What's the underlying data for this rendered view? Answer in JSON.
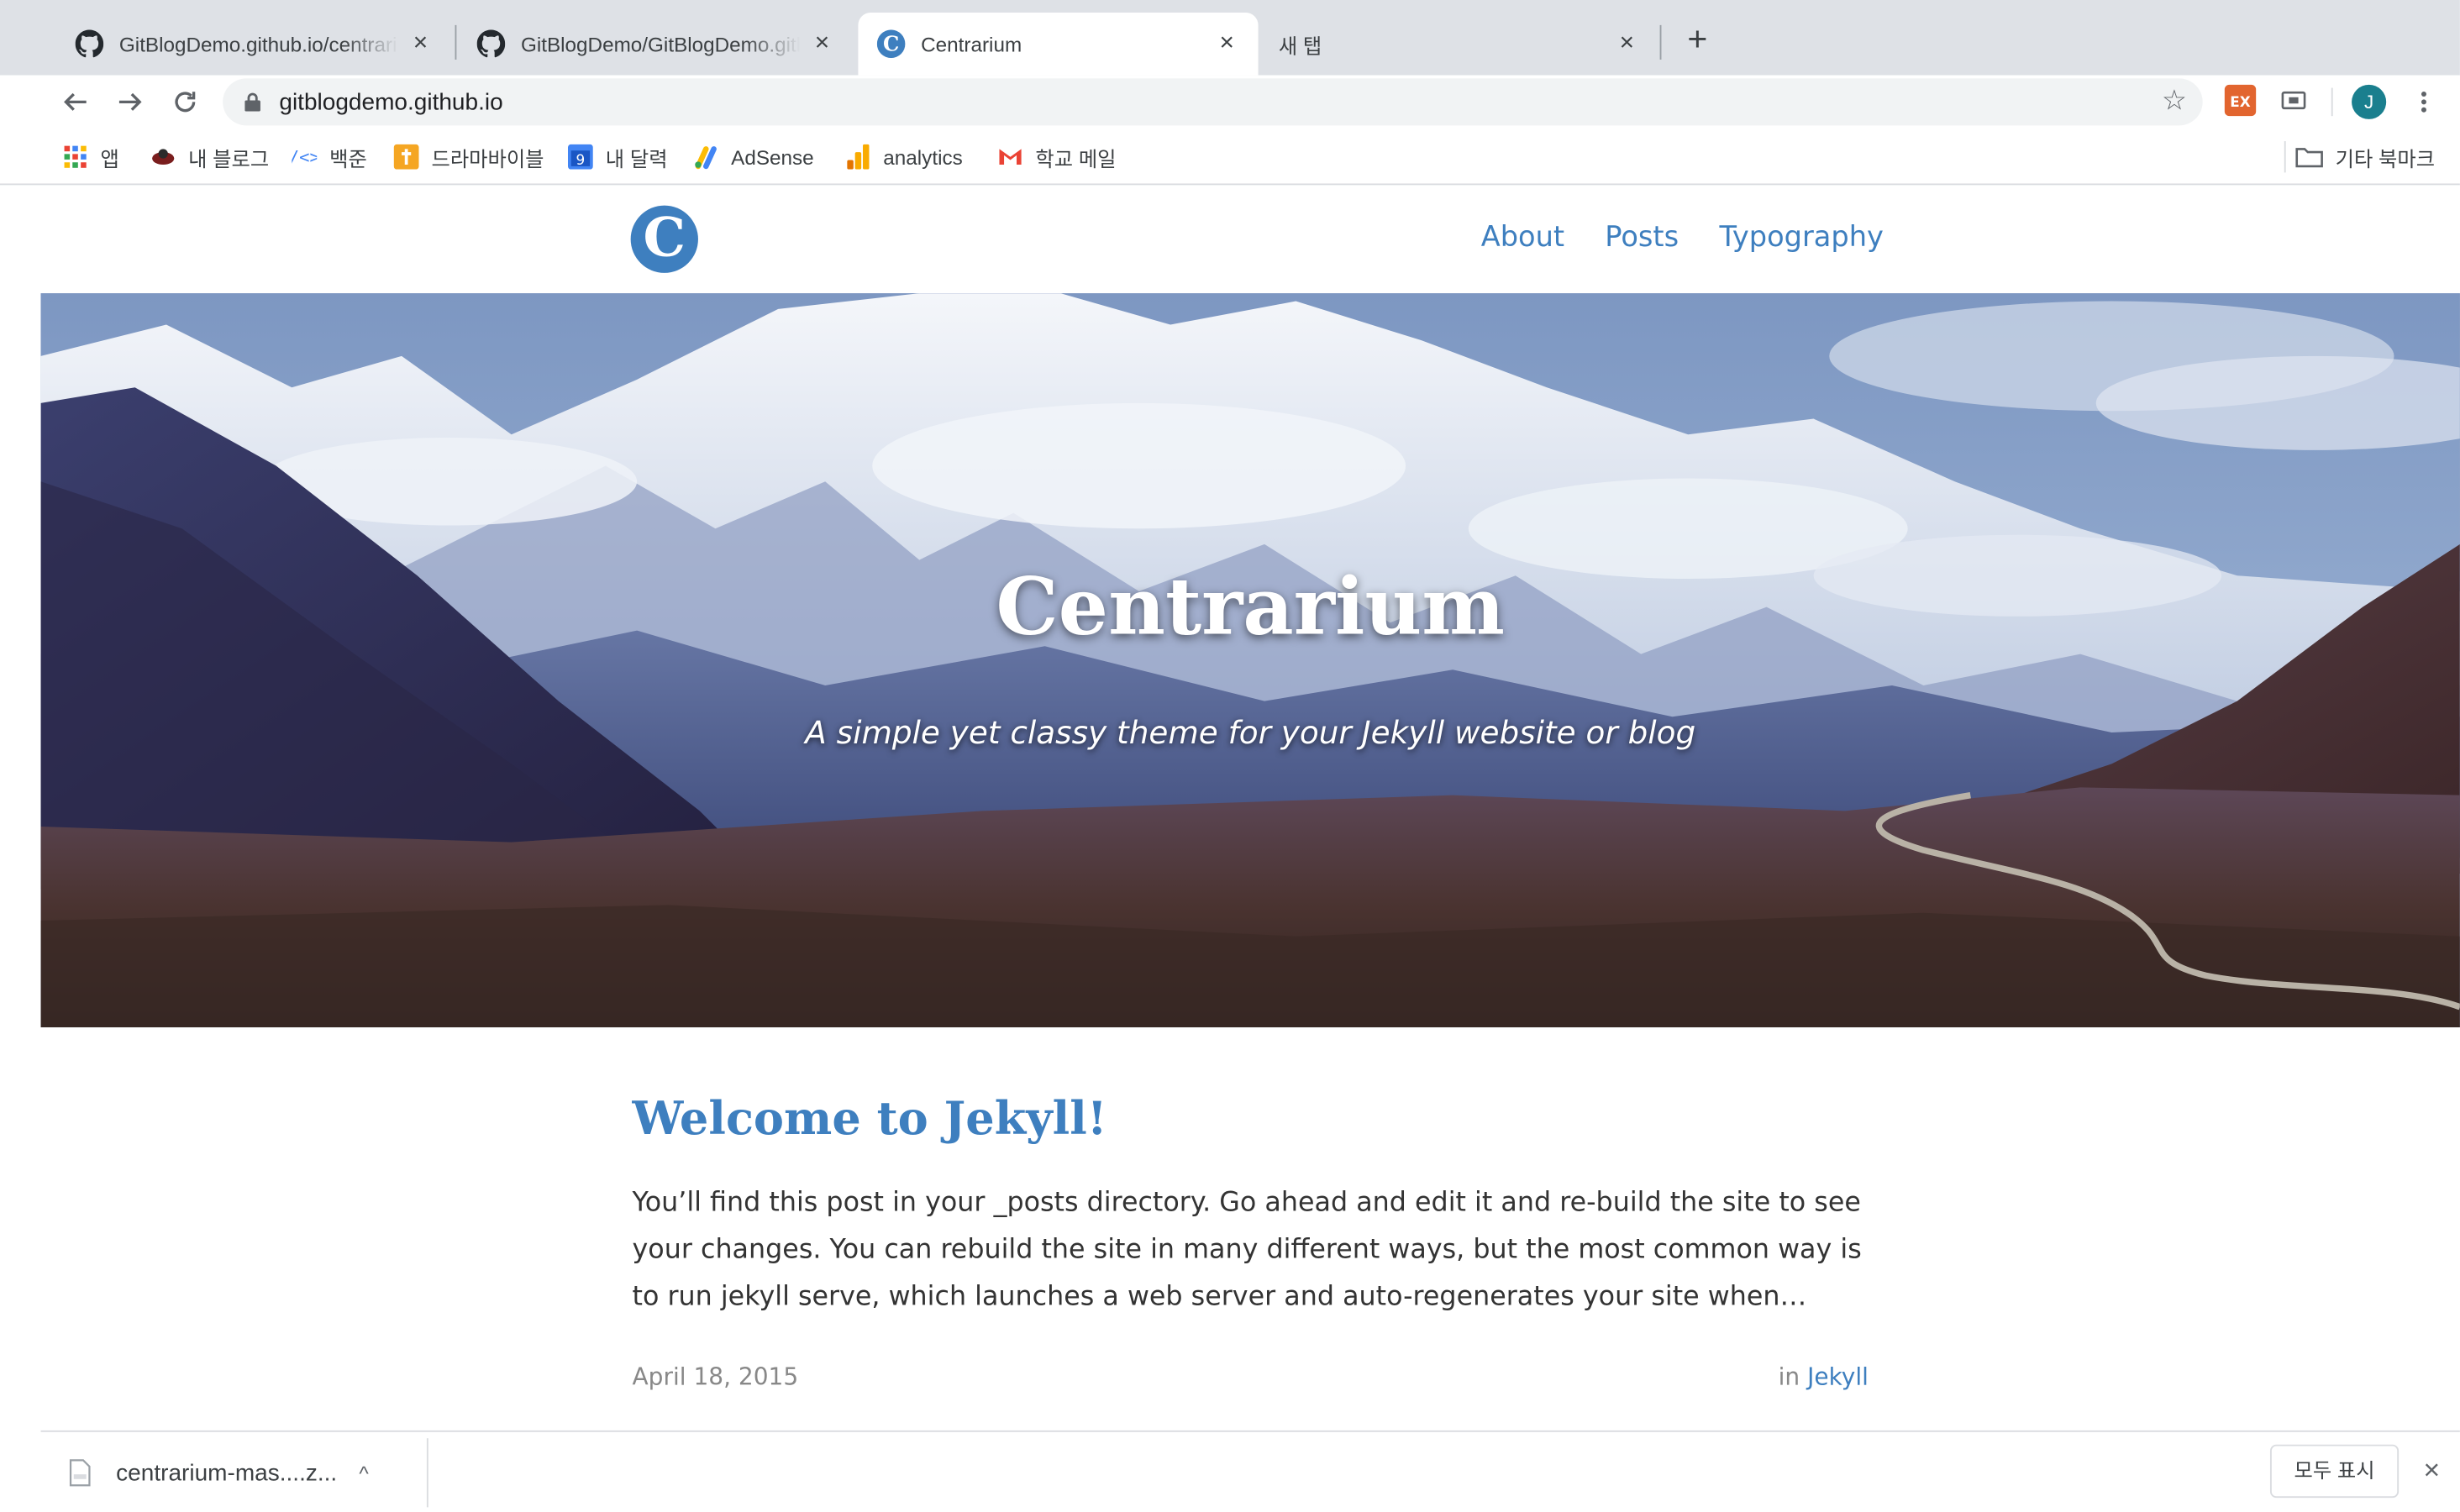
{
  "browser": {
    "tabs": [
      {
        "title": "GitBlogDemo.github.io/centrarium",
        "icon": "github-icon",
        "active": false
      },
      {
        "title": "GitBlogDemo/GitBlogDemo.github.io",
        "icon": "github-icon",
        "active": false
      },
      {
        "title": "Centrarium",
        "icon": "centrarium-favicon",
        "active": true
      },
      {
        "title": "새 탭",
        "icon": "",
        "active": false
      }
    ],
    "new_tab_label": "+",
    "url": "gitblogdemo.github.io",
    "profile_initial": "J",
    "bookmarks": [
      {
        "label": "앱",
        "icon": "apps-grid-icon"
      },
      {
        "label": "내 블로그",
        "icon": "blog-icon"
      },
      {
        "label": "백준",
        "icon": "code-icon"
      },
      {
        "label": "드라마바이블",
        "icon": "drama-icon"
      },
      {
        "label": "내 달력",
        "icon": "calendar-icon"
      },
      {
        "label": "AdSense",
        "icon": "adsense-icon"
      },
      {
        "label": "analytics",
        "icon": "analytics-icon"
      },
      {
        "label": "학교 메일",
        "icon": "gmail-icon"
      }
    ],
    "calendar_day": "9",
    "other_bookmarks": "기타 북마크"
  },
  "site": {
    "logo_letter": "C",
    "nav": [
      "About",
      "Posts",
      "Typography"
    ],
    "hero_title": "Centrarium",
    "hero_subtitle": "A simple yet classy theme for your Jekyll website or blog",
    "post": {
      "title": "Welcome to Jekyll!",
      "excerpt": "You’ll find this post in your _posts directory. Go ahead and edit it and re-build the site to see your changes. You can rebuild the site in many different ways, but the most common way is to run jekyll serve, which launches a web server and auto-regenerates your site when…",
      "date": "April 18, 2015",
      "category_prefix": "in",
      "category": "Jekyll"
    }
  },
  "downloads": {
    "file_name": "centrarium-mas....z...",
    "show_all": "모두 표시"
  },
  "colors": {
    "accent": "#3e7fbf",
    "tabstrip": "#dee1e6"
  }
}
